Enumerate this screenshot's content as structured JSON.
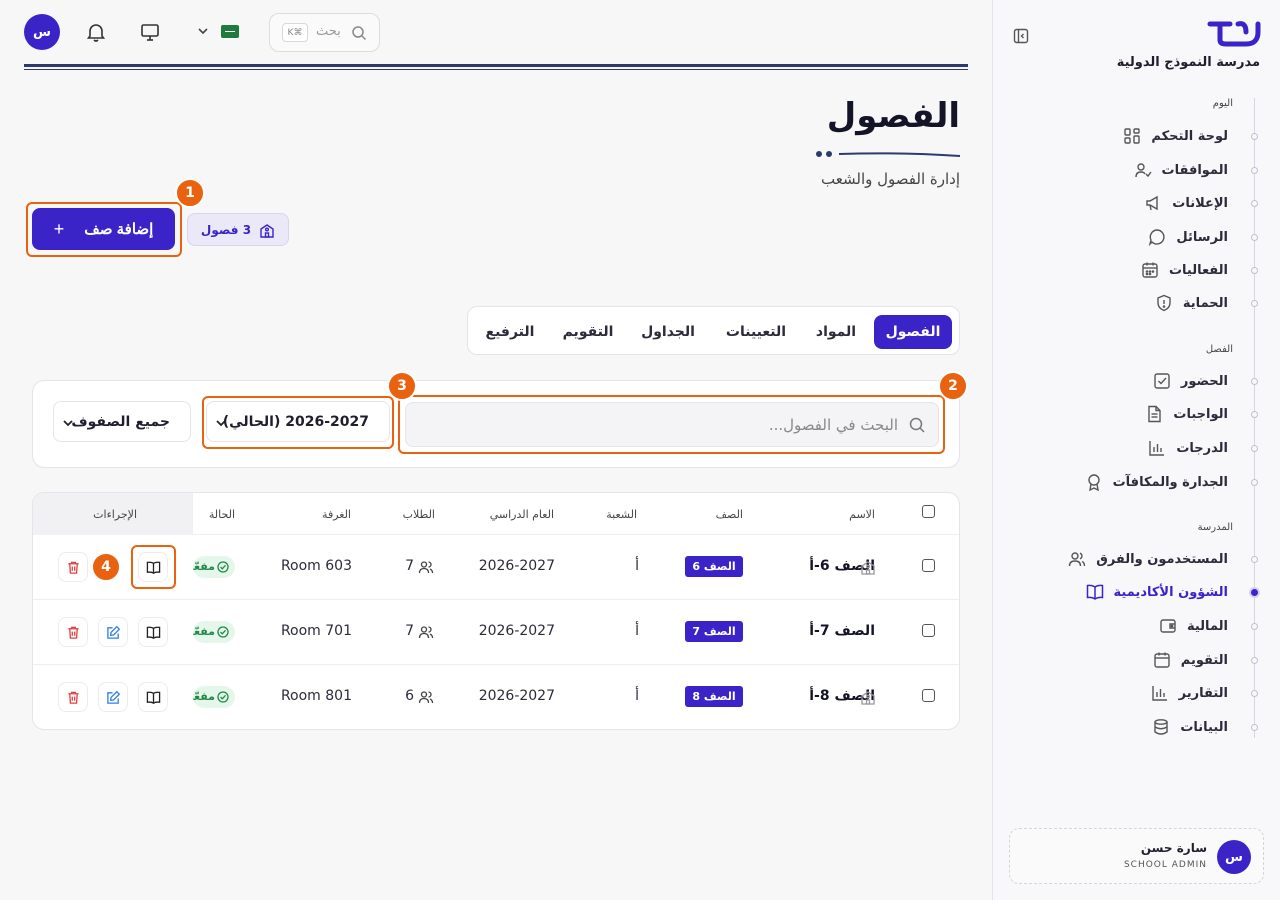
{
  "sidebar": {
    "school_name": "مدرسة النموذج الدولية",
    "sections": [
      {
        "label": "اليوم",
        "items": [
          "لوحة التحكم",
          "الموافقات",
          "الإعلانات",
          "الرسائل",
          "الفعاليات",
          "الحماية"
        ]
      },
      {
        "label": "الفصل",
        "items": [
          "الحضور",
          "الواجبات",
          "الدرجات",
          "الجدارة والمكافآت"
        ]
      },
      {
        "label": "المدرسة",
        "items": [
          "المستخدمون والفرق",
          "الشؤون الأكاديمية",
          "المالية",
          "التقويم",
          "التقارير",
          "البيانات"
        ]
      }
    ],
    "active_item": "الشؤون الأكاديمية",
    "user": {
      "initial": "س",
      "name": "سارة حسن",
      "role": "SCHOOL ADMIN"
    }
  },
  "topbar": {
    "avatar_initial": "س",
    "search_placeholder": "بحث",
    "search_shortcut": "K⌘",
    "language_flag": "saudi-flag"
  },
  "page": {
    "title": "الفصول",
    "subtitle": "إدارة الفصول والشعب",
    "add_button": "إضافة صف",
    "add_icon": "+",
    "count_badge": "3 فصول"
  },
  "tabs": [
    "الفصول",
    "المواد",
    "التعيينات",
    "الجداول",
    "التقويم",
    "الترفيع"
  ],
  "active_tab": "الفصول",
  "filters": {
    "search_placeholder": "البحث في الفصول...",
    "year_select": "2026-2027 (الحالي)",
    "grade_select": "جميع الصفوف"
  },
  "table": {
    "headers": {
      "name": "الاسم",
      "grade": "الصف",
      "section": "الشعبة",
      "year": "العام الدراسي",
      "students": "الطلاب",
      "room": "الغرفة",
      "status": "الحالة",
      "actions": "الإجراءات"
    },
    "rows": [
      {
        "name": "الصف 6-أ",
        "grade": "الصف 6",
        "section": "أ",
        "year": "2026-2027",
        "students": "7",
        "room": "Room 603",
        "status": "مفعّل"
      },
      {
        "name": "الصف 7-أ",
        "grade": "الصف 7",
        "section": "أ",
        "year": "2026-2027",
        "students": "7",
        "room": "Room 701",
        "status": "مفعّل"
      },
      {
        "name": "الصف 8-أ",
        "grade": "الصف 8",
        "section": "أ",
        "year": "2026-2027",
        "students": "6",
        "room": "Room 801",
        "status": "مفعّل"
      }
    ]
  },
  "annotations": [
    "1",
    "2",
    "3",
    "4"
  ],
  "colors": {
    "accent": "#3a24c8",
    "highlight": "#e8620f",
    "status_bg": "#e5f6ea",
    "status_text": "#1f8a48",
    "delete": "#e04040",
    "edit": "#2f7ee8"
  }
}
